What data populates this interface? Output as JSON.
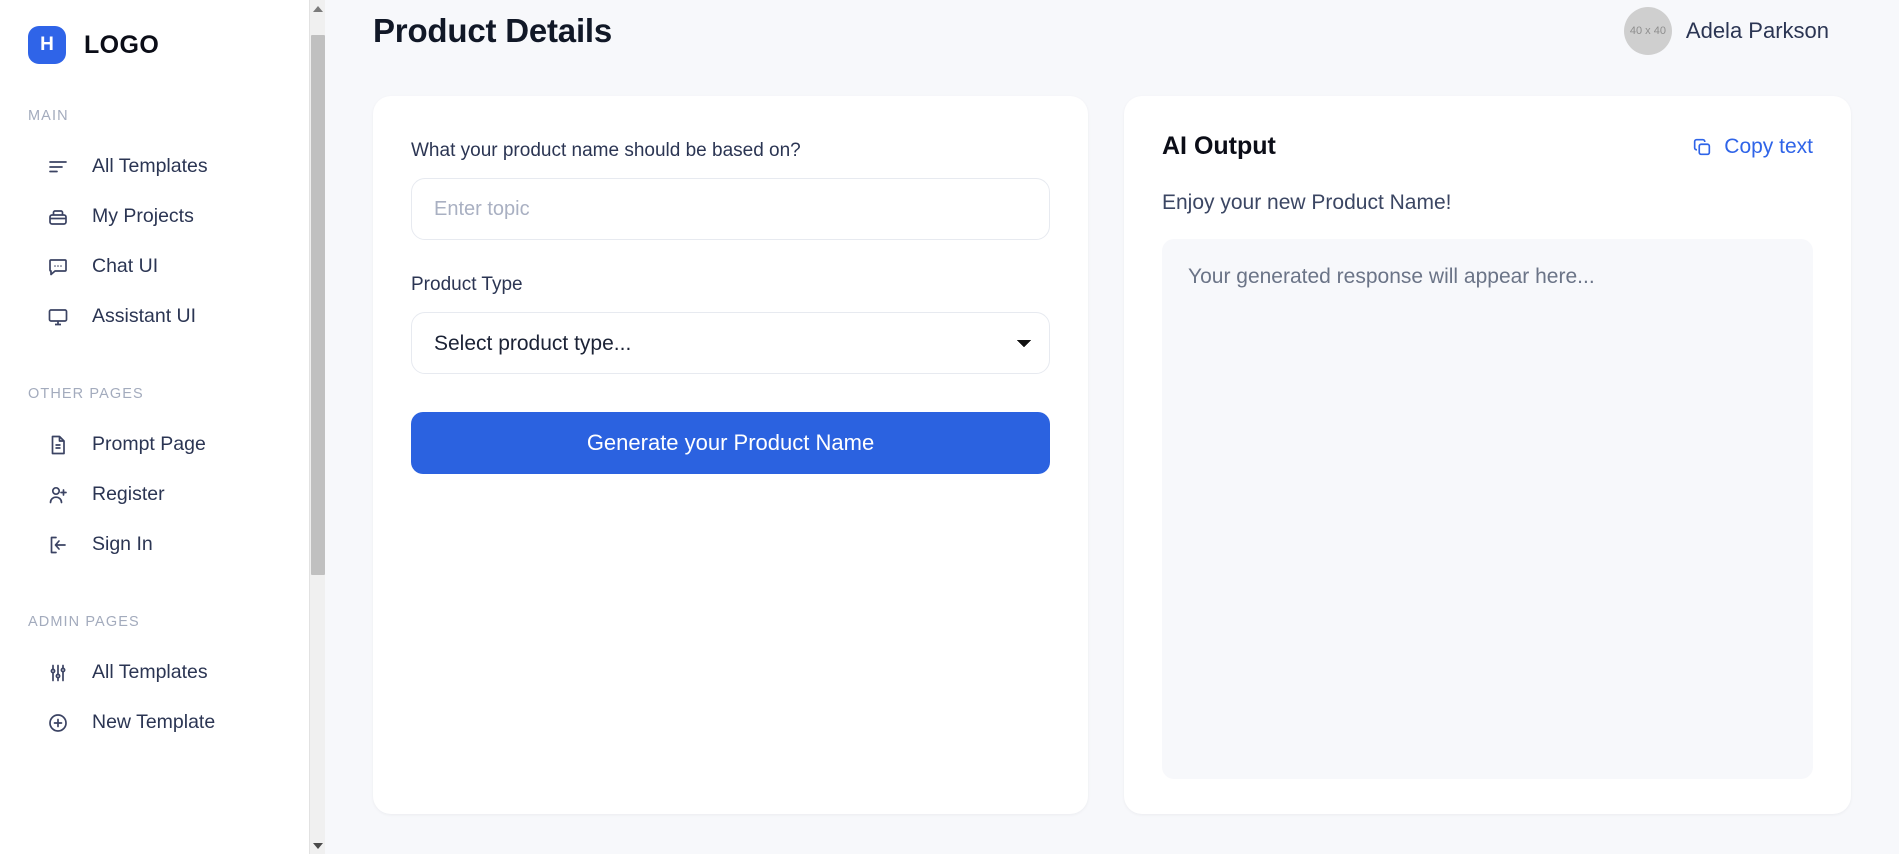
{
  "sidebar": {
    "brand": {
      "badge_letter": "H",
      "name": "LOGO"
    },
    "sections": [
      {
        "label": "MAIN",
        "items": [
          {
            "label": "All Templates",
            "icon": "align-left-icon"
          },
          {
            "label": "My Projects",
            "icon": "briefcase-icon"
          },
          {
            "label": "Chat UI",
            "icon": "chat-bubble-icon"
          },
          {
            "label": "Assistant UI",
            "icon": "monitor-icon"
          }
        ]
      },
      {
        "label": "OTHER PAGES",
        "items": [
          {
            "label": "Prompt Page",
            "icon": "document-icon"
          },
          {
            "label": "Register",
            "icon": "user-plus-icon"
          },
          {
            "label": "Sign In",
            "icon": "sign-in-icon"
          }
        ]
      },
      {
        "label": "ADMIN PAGES",
        "items": [
          {
            "label": "All Templates",
            "icon": "sliders-icon"
          },
          {
            "label": "New Template",
            "icon": "plus-circle-icon"
          }
        ]
      }
    ]
  },
  "header": {
    "title": "Product Details",
    "user": {
      "name": "Adela Parkson",
      "avatar_placeholder": "40 x 40"
    }
  },
  "form": {
    "topic_label": "What your product name should be based on?",
    "topic_placeholder": "Enter topic",
    "topic_value": "",
    "product_type_label": "Product Type",
    "product_type_selected": "Select product type...",
    "generate_label": "Generate your Product Name"
  },
  "output": {
    "title": "AI Output",
    "copy_label": "Copy text",
    "subtitle": "Enjoy your new Product Name!",
    "placeholder": "Your generated response will appear here..."
  },
  "colors": {
    "accent": "#2b62e0",
    "brand_badge": "#2f64e8",
    "page_bg": "#f7f8fb",
    "card_bg": "#ffffff"
  }
}
